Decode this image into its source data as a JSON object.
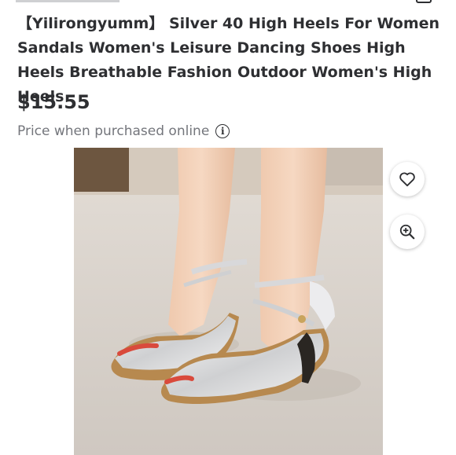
{
  "product": {
    "title": "【Yilirongyumm】 Silver 40 High Heels For Women Sandals Women's Leisure Dancing Shoes High Heels Breathable Fashion Outdoor Women's High Heels",
    "price": "$15.55",
    "price_note": "Price when purchased online",
    "info_glyph": "i"
  },
  "icons": {
    "favorite": "heart-icon",
    "zoom": "zoom-in-icon",
    "info": "info-icon"
  },
  "colors": {
    "text": "#2e2f32",
    "muted": "#74767c"
  }
}
